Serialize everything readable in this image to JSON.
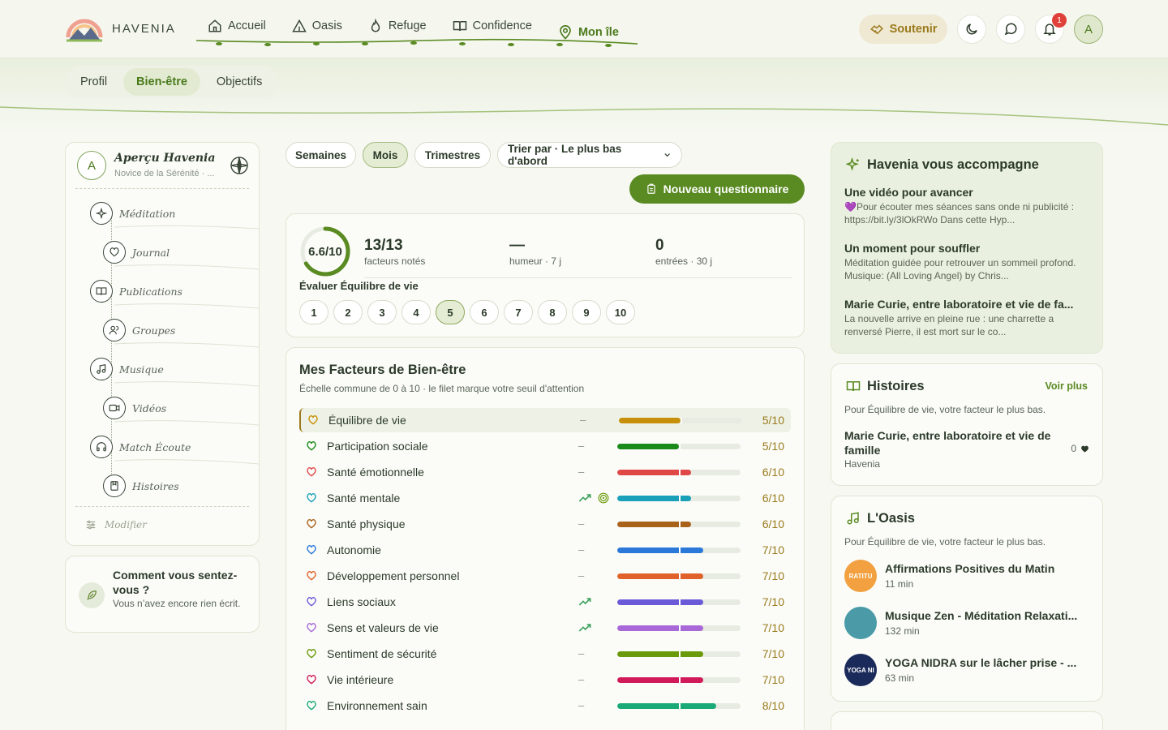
{
  "brand": {
    "name": "HAVENIA"
  },
  "nav": {
    "items": [
      {
        "label": "Accueil",
        "icon": "home-icon"
      },
      {
        "label": "Oasis",
        "icon": "tent-icon"
      },
      {
        "label": "Refuge",
        "icon": "flame-icon"
      },
      {
        "label": "Confidence",
        "icon": "book-icon"
      },
      {
        "label": "Mon île",
        "icon": "map-pin-icon",
        "active": true
      }
    ]
  },
  "header": {
    "support_label": "Soutenir",
    "notif_count": "1",
    "avatar_letter": "A"
  },
  "subtabs": [
    {
      "label": "Profil"
    },
    {
      "label": "Bien-être",
      "active": true
    },
    {
      "label": "Objectifs"
    }
  ],
  "left_panel": {
    "avatar_letter": "A",
    "title": "Aperçu Havenia",
    "subtitle": "Novice de la Sérénité · ...",
    "items": [
      {
        "label": "Méditation",
        "icon": "sparkle-icon"
      },
      {
        "label": "Journal",
        "icon": "heart-icon"
      },
      {
        "label": "Publications",
        "icon": "book-open-icon"
      },
      {
        "label": "Groupes",
        "icon": "users-icon"
      },
      {
        "label": "Musique",
        "icon": "music-icon"
      },
      {
        "label": "Vidéos",
        "icon": "video-icon"
      },
      {
        "label": "Match Écoute",
        "icon": "headphones-icon"
      },
      {
        "label": "Histoires",
        "icon": "book-bookmark-icon"
      }
    ],
    "modify_label": "Modifier"
  },
  "mood_card": {
    "title": "Comment vous sentez-vous ?",
    "subtitle": "Vous n’avez encore rien écrit."
  },
  "filters": {
    "periods": [
      {
        "label": "Semaines"
      },
      {
        "label": "Mois",
        "active": true
      },
      {
        "label": "Trimestres"
      }
    ],
    "sort_label": "Trier par · Le plus bas d'abord",
    "new_button": "Nouveau questionnaire"
  },
  "score_card": {
    "score": "6.6/10",
    "score_fraction": 0.66,
    "rated": "13/13",
    "rated_label": "facteurs notés",
    "mood": "—",
    "mood_label": "humeur · 7 j",
    "entries": "0",
    "entries_label": "entrées · 30 j",
    "eval_label": "Évaluer Équilibre de vie",
    "rating_options": [
      "1",
      "2",
      "3",
      "4",
      "5",
      "6",
      "7",
      "8",
      "9",
      "10"
    ],
    "selected_rating": "5"
  },
  "factors": {
    "title": "Mes Facteurs de Bien-être",
    "subtitle": "Échelle commune de 0 à 10 · le filet marque votre seuil d'attention",
    "rows": [
      {
        "name": "Équilibre de vie",
        "trend": "–",
        "score": "5/10",
        "value": 5,
        "color": "#c8900a",
        "active": true
      },
      {
        "name": "Participation sociale",
        "trend": "–",
        "score": "5/10",
        "value": 5,
        "color": "#1a8a1a"
      },
      {
        "name": "Santé émotionnelle",
        "trend": "–",
        "score": "6/10",
        "value": 6,
        "color": "#e04848"
      },
      {
        "name": "Santé mentale",
        "trend": "up",
        "target": true,
        "score": "6/10",
        "value": 6,
        "color": "#1aa0b8"
      },
      {
        "name": "Santé physique",
        "trend": "–",
        "score": "6/10",
        "value": 6,
        "color": "#a8621a"
      },
      {
        "name": "Autonomie",
        "trend": "–",
        "score": "7/10",
        "value": 7,
        "color": "#2a78d8"
      },
      {
        "name": "Développement personnel",
        "trend": "–",
        "score": "7/10",
        "value": 7,
        "color": "#e0622a"
      },
      {
        "name": "Liens sociaux",
        "trend": "up",
        "score": "7/10",
        "value": 7,
        "color": "#6a5ad8"
      },
      {
        "name": "Sens et valeurs de vie",
        "trend": "up",
        "score": "7/10",
        "value": 7,
        "color": "#a868d8"
      },
      {
        "name": "Sentiment de sécurité",
        "trend": "–",
        "score": "7/10",
        "value": 7,
        "color": "#6a9a0a"
      },
      {
        "name": "Vie intérieure",
        "trend": "–",
        "score": "7/10",
        "value": 7,
        "color": "#d01a5a"
      },
      {
        "name": "Environnement sain",
        "trend": "–",
        "score": "8/10",
        "value": 8,
        "color": "#1aaa78"
      }
    ]
  },
  "accompany": {
    "title": "Havenia vous accompagne",
    "items": [
      {
        "title": "Une vidéo pour avancer",
        "text": "💜Pour écouter mes séances sans onde ni publicité : https://bit.ly/3lOkRWo Dans cette Hyp..."
      },
      {
        "title": "Un moment pour souffler",
        "text": "Méditation guidée pour retrouver un sommeil profond. Musique: (All Loving Angel) by Chris..."
      },
      {
        "title": "Marie Curie, entre laboratoire et vie de fa...",
        "text": "La nouvelle arrive en pleine rue : une charrette a renversé Pierre, il est mort sur le co..."
      }
    ]
  },
  "stories": {
    "title": "Histoires",
    "more": "Voir plus",
    "intro": "Pour Équilibre de vie, votre facteur le plus bas.",
    "item_title": "Marie Curie, entre laboratoire et vie de famille",
    "item_author": "Havenia",
    "likes": "0"
  },
  "oasis": {
    "title": "L'Oasis",
    "intro": "Pour Équilibre de vie, votre facteur le plus bas.",
    "items": [
      {
        "title": "Affirmations Positives du Matin",
        "duration": "11 min",
        "thumb_label": "RATITU",
        "color": "#f2a040"
      },
      {
        "title": "Musique Zen - Méditation Relaxati...",
        "duration": "132 min",
        "thumb_label": "",
        "color": "#4a9aa8"
      },
      {
        "title": "YOGA NIDRA sur le lâcher prise - ...",
        "duration": "63 min",
        "thumb_label": "YOGA NI",
        "color": "#1a2a5a"
      }
    ]
  }
}
